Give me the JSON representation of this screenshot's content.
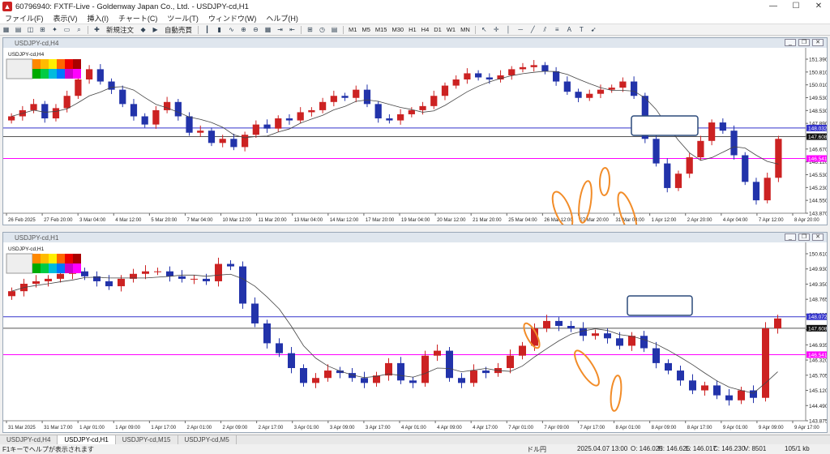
{
  "window": {
    "title": "60796940: FXTF-Live - Goldenway Japan Co., Ltd. - USDJPY-cd,H1",
    "icon": "app-logo-icon"
  },
  "menu": [
    "ファイル(F)",
    "表示(V)",
    "挿入(I)",
    "チャート(C)",
    "ツール(T)",
    "ウィンドウ(W)",
    "ヘルプ(H)"
  ],
  "toolbar": {
    "new_order": "新規注文",
    "auto_trade": "自動売買",
    "timeframes": [
      "M1",
      "M5",
      "M15",
      "M30",
      "H1",
      "H4",
      "D1",
      "W1",
      "MN"
    ]
  },
  "charts": [
    {
      "window_title": "USDJPY-cd,H4",
      "symbol_label": "USDJPY-cd,H4",
      "y_ticks": [
        "151.390",
        "150.810",
        "150.010",
        "149.530",
        "148.530",
        "147.890",
        "147.290",
        "146.670",
        "146.120",
        "145.530",
        "145.230",
        "144.550",
        "143.870"
      ],
      "y_min": 143.87,
      "y_max": 151.39,
      "lines": {
        "blue": 148.03,
        "black": 147.608,
        "magenta": 146.541
      },
      "price_labels": {
        "blue": "148.032",
        "black": "147.608",
        "magenta": "146.541"
      },
      "x_labels": [
        "26 Feb 2025",
        "27 Feb 20:00",
        "3 Mar 04:00",
        "4 Mar 12:00",
        "5 Mar 20:00",
        "7 Mar 04:00",
        "10 Mar 12:00",
        "11 Mar 20:00",
        "13 Mar 04:00",
        "14 Mar 12:00",
        "17 Mar 20:00",
        "19 Mar 04:00",
        "20 Mar 12:00",
        "21 Mar 20:00",
        "25 Mar 04:00",
        "26 Mar 12:00",
        "27 Mar 20:00",
        "31 Mar 04:00",
        "1 Apr 12:00",
        "2 Apr 20:00",
        "4 Apr 04:00",
        "7 Apr 12:00",
        "8 Apr 20:00"
      ],
      "series": [
        148.6,
        148.9,
        149.2,
        148.5,
        149.0,
        149.6,
        150.4,
        150.9,
        150.3,
        149.9,
        149.2,
        148.6,
        148.2,
        148.9,
        149.3,
        148.6,
        147.8,
        147.9,
        147.3,
        147.5,
        147.1,
        147.7,
        148.2,
        148.0,
        148.5,
        148.4,
        148.8,
        148.9,
        149.3,
        149.6,
        149.5,
        149.9,
        149.2,
        148.5,
        148.4,
        148.7,
        148.9,
        149.1,
        149.6,
        150.1,
        150.4,
        150.7,
        150.5,
        150.4,
        150.6,
        150.9,
        151.0,
        151.1,
        150.8,
        150.3,
        149.8,
        149.5,
        149.7,
        149.9,
        150.0,
        150.3,
        149.6,
        147.5,
        146.3,
        145.1,
        145.8,
        146.6,
        147.4,
        148.3,
        147.9,
        146.7,
        145.4,
        144.5,
        145.6,
        147.5
      ]
    },
    {
      "window_title": "USDJPY-cd,H1",
      "symbol_label": "USDJPY-cd,H1",
      "y_ticks": [
        "150.610",
        "149.930",
        "149.350",
        "148.765",
        "148.110",
        "147.525",
        "146.935",
        "146.320",
        "145.705",
        "145.120",
        "144.490",
        "143.875"
      ],
      "y_min": 143.875,
      "y_max": 150.61,
      "lines": {
        "blue": 148.07,
        "black": 147.608,
        "magenta": 146.541
      },
      "price_labels": {
        "blue": "148.072",
        "black": "147.608",
        "magenta": "146.541"
      },
      "x_labels": [
        "31 Mar 2025",
        "31 Mar 17:00",
        "1 Apr 01:00",
        "1 Apr 09:00",
        "1 Apr 17:00",
        "2 Apr 01:00",
        "2 Apr 09:00",
        "2 Apr 17:00",
        "3 Apr 01:00",
        "3 Apr 09:00",
        "3 Apr 17:00",
        "4 Apr 01:00",
        "4 Apr 09:00",
        "4 Apr 17:00",
        "7 Apr 01:00",
        "7 Apr 09:00",
        "7 Apr 17:00",
        "8 Apr 01:00",
        "8 Apr 09:00",
        "8 Apr 17:00",
        "9 Apr 01:00",
        "9 Apr 09:00",
        "9 Apr 17:00"
      ],
      "series": [
        149.1,
        149.4,
        149.5,
        149.6,
        149.8,
        149.9,
        149.7,
        149.5,
        149.3,
        149.6,
        149.8,
        149.9,
        149.9,
        149.7,
        149.6,
        149.6,
        149.5,
        150.2,
        150.1,
        148.6,
        147.8,
        147.0,
        146.6,
        146.0,
        145.4,
        145.6,
        145.9,
        145.8,
        145.6,
        145.4,
        145.7,
        146.2,
        145.5,
        145.4,
        146.5,
        146.7,
        145.6,
        145.4,
        145.9,
        145.8,
        146.0,
        146.5,
        146.9,
        147.6,
        147.9,
        147.7,
        147.6,
        147.3,
        147.4,
        147.2,
        146.9,
        147.3,
        146.8,
        146.2,
        145.9,
        145.5,
        145.1,
        145.3,
        144.9,
        144.7,
        145.1,
        144.8,
        147.6,
        148.0
      ]
    }
  ],
  "tabs": [
    "USDJPY-cd,H4",
    "USDJPY-cd,H1",
    "USDJPY-cd,M15",
    "USDJPY-cd,M5"
  ],
  "status": {
    "help": "F1キーでヘルプが表示されます",
    "profile": "ドル円",
    "datetime": "2025.04.07 13:00",
    "open": "O: 146.025",
    "high": "H: 146.625",
    "low": "L: 146.017",
    "close": "C: 146.230",
    "volume": "V: 8501",
    "traffic": "105/1 kb"
  },
  "colors": {
    "blue_line": "#3333cc",
    "magenta_line": "#ff00ff",
    "bull": "#cc2222",
    "bear": "#2233aa",
    "annotation": "#f28c28"
  }
}
